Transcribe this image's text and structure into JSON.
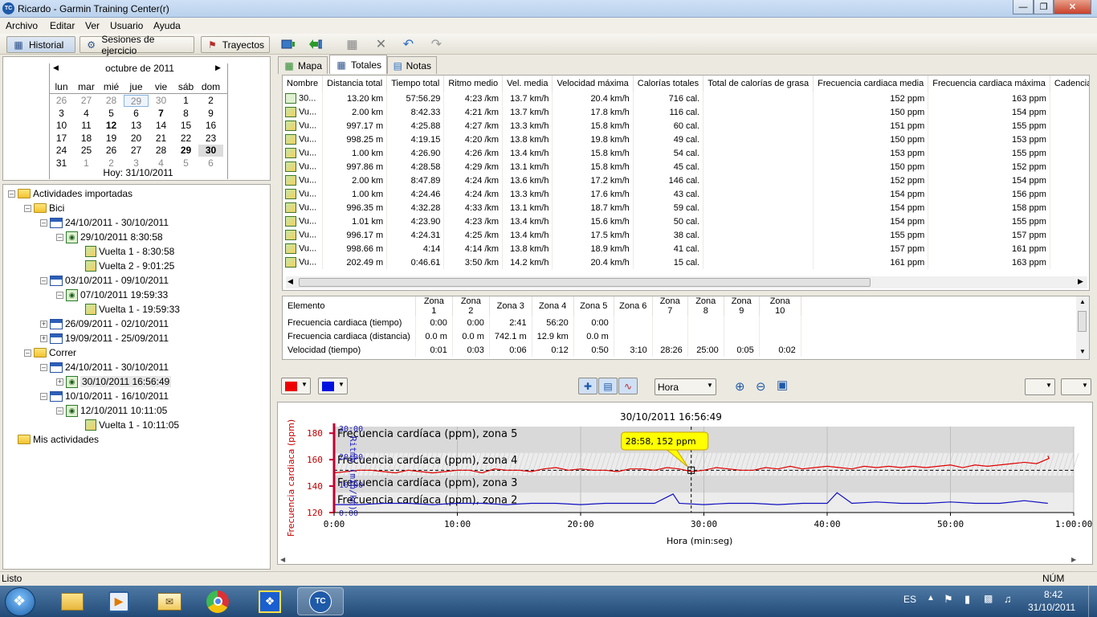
{
  "window": {
    "title": "Ricardo - Garmin Training Center(r)",
    "icon_text": "TC"
  },
  "menu": [
    "Archivo",
    "Editar",
    "Ver",
    "Usuario",
    "Ayuda"
  ],
  "toolbar": {
    "historial": "Historial",
    "sesiones": "Sesiones de ejercicio",
    "trayectos": "Trayectos"
  },
  "calendar": {
    "month": "octubre de 2011",
    "weekdays": [
      "lun",
      "mar",
      "mié",
      "jue",
      "vie",
      "sáb",
      "dom"
    ],
    "weeks": [
      [
        "26",
        "27",
        "28",
        "29",
        "30",
        "1",
        "2"
      ],
      [
        "3",
        "4",
        "5",
        "6",
        "7",
        "8",
        "9"
      ],
      [
        "10",
        "11",
        "12",
        "13",
        "14",
        "15",
        "16"
      ],
      [
        "17",
        "18",
        "19",
        "20",
        "21",
        "22",
        "23"
      ],
      [
        "24",
        "25",
        "26",
        "27",
        "28",
        "29",
        "30"
      ],
      [
        "31",
        "1",
        "2",
        "3",
        "4",
        "5",
        "6"
      ]
    ],
    "today": "Hoy: 31/10/2011"
  },
  "tree": {
    "root": "Actividades importadas",
    "bici": "Bici",
    "week1": "24/10/2011 - 30/10/2011",
    "act1": "29/10/2011 8:30:58",
    "lap1": "Vuelta 1 - 8:30:58",
    "lap2": "Vuelta 2 - 9:01:25",
    "week2": "03/10/2011 - 09/10/2011",
    "act2": "07/10/2011 19:59:33",
    "lap3": "Vuelta 1 - 19:59:33",
    "week3": "26/09/2011 - 02/10/2011",
    "week4": "19/09/2011 - 25/09/2011",
    "correr": "Correr",
    "week5": "24/10/2011 - 30/10/2011",
    "act3": "30/10/2011 16:56:49",
    "week6": "10/10/2011 - 16/10/2011",
    "act4": "12/10/2011 10:11:05",
    "lap4": "Vuelta 1 - 10:11:05",
    "mis": "Mis actividades"
  },
  "tabs": {
    "mapa": "Mapa",
    "totales": "Totales",
    "notas": "Notas"
  },
  "totals": {
    "columns": [
      "Nombre",
      "Distancia total",
      "Tiempo total",
      "Ritmo medio",
      "Vel. media",
      "Velocidad máxima",
      "Calorías totales",
      "Total de calorías de grasa",
      "Frecuencia cardiaca media",
      "Frecuencia cardiaca máxima",
      "Cadencia med"
    ],
    "rows": [
      [
        "30...",
        "13.20 km",
        "57:56.29",
        "4:23 /km",
        "13.7 km/h",
        "20.4 km/h",
        "716 cal.",
        "",
        "152 ppm",
        "163 ppm",
        ""
      ],
      [
        "Vu...",
        "2.00 km",
        "8:42.33",
        "4:21 /km",
        "13.7 km/h",
        "17.8 km/h",
        "116 cal.",
        "",
        "150 ppm",
        "154 ppm",
        ""
      ],
      [
        "Vu...",
        "997.17 m",
        "4:25.88",
        "4:27 /km",
        "13.3 km/h",
        "15.8 km/h",
        "60 cal.",
        "",
        "151 ppm",
        "155 ppm",
        ""
      ],
      [
        "Vu...",
        "998.25 m",
        "4:19.15",
        "4:20 /km",
        "13.8 km/h",
        "19.8 km/h",
        "49 cal.",
        "",
        "150 ppm",
        "153 ppm",
        ""
      ],
      [
        "Vu...",
        "1.00 km",
        "4:26.90",
        "4:26 /km",
        "13.4 km/h",
        "15.8 km/h",
        "54 cal.",
        "",
        "153 ppm",
        "155 ppm",
        ""
      ],
      [
        "Vu...",
        "997.86 m",
        "4:28.58",
        "4:29 /km",
        "13.1 km/h",
        "15.8 km/h",
        "45 cal.",
        "",
        "150 ppm",
        "152 ppm",
        ""
      ],
      [
        "Vu...",
        "2.00 km",
        "8:47.89",
        "4:24 /km",
        "13.6 km/h",
        "17.2 km/h",
        "146 cal.",
        "",
        "152 ppm",
        "154 ppm",
        ""
      ],
      [
        "Vu...",
        "1.00 km",
        "4:24.46",
        "4:24 /km",
        "13.3 km/h",
        "17.6 km/h",
        "43 cal.",
        "",
        "154 ppm",
        "156 ppm",
        ""
      ],
      [
        "Vu...",
        "996.35 m",
        "4:32.28",
        "4:33 /km",
        "13.1 km/h",
        "18.7 km/h",
        "59 cal.",
        "",
        "154 ppm",
        "158 ppm",
        ""
      ],
      [
        "Vu...",
        "1.01 km",
        "4:23.90",
        "4:23 /km",
        "13.4 km/h",
        "15.6 km/h",
        "50 cal.",
        "",
        "154 ppm",
        "155 ppm",
        ""
      ],
      [
        "Vu...",
        "996.17 m",
        "4:24.31",
        "4:25 /km",
        "13.4 km/h",
        "17.5 km/h",
        "38 cal.",
        "",
        "155 ppm",
        "157 ppm",
        ""
      ],
      [
        "Vu...",
        "998.66 m",
        "4:14",
        "4:14 /km",
        "13.8 km/h",
        "18.9 km/h",
        "41 cal.",
        "",
        "157 ppm",
        "161 ppm",
        ""
      ],
      [
        "Vu...",
        "202.49 m",
        "0:46.61",
        "3:50 /km",
        "14.2 km/h",
        "20.4 km/h",
        "15 cal.",
        "",
        "161 ppm",
        "163 ppm",
        ""
      ]
    ]
  },
  "zones": {
    "columns": [
      "Elemento",
      "Zona 1",
      "Zona 2",
      "Zona 3",
      "Zona 4",
      "Zona 5",
      "Zona 6",
      "Zona 7",
      "Zona 8",
      "Zona 9",
      "Zona 10"
    ],
    "rows": [
      [
        "Frecuencia cardiaca (tiempo)",
        "0:00",
        "0:00",
        "2:41",
        "56:20",
        "0:00",
        "",
        "",
        "",
        "",
        ""
      ],
      [
        "Frecuencia cardiaca (distancia)",
        "0.0 m",
        "0.0 m",
        "742.1 m",
        "12.9 km",
        "0.0 m",
        "",
        "",
        "",
        "",
        ""
      ],
      [
        "Velocidad (tiempo)",
        "0:01",
        "0:03",
        "0:06",
        "0:12",
        "0:50",
        "3:10",
        "28:26",
        "25:00",
        "0:05",
        "0:02"
      ]
    ]
  },
  "chart_controls": {
    "xaxis_select": "Hora"
  },
  "chart_data": {
    "type": "line",
    "title": "30/10/2011 16:56:49",
    "xlabel": "Hora (min:seg)",
    "ylabel": "Frecuencia cardiaca (ppm)",
    "y2label": "Ritmo (min/km)",
    "xticks": [
      "0:00",
      "10:00",
      "20:00",
      "30:00",
      "40:00",
      "50:00",
      "1:00:00"
    ],
    "xlim": [
      0,
      60
    ],
    "ylim": [
      120,
      185
    ],
    "yticks": [
      "120",
      "140",
      "160",
      "180"
    ],
    "y2ticks": [
      "0:00",
      "10:00",
      "20:00",
      "30:00"
    ],
    "zones": [
      "Frecuencia cardíaca (ppm), zona 5",
      "Frecuencia cardíaca (ppm), zona 4",
      "Frecuencia cardíaca (ppm), zona 3",
      "Frecuencia cardíaca (ppm), zona 2"
    ],
    "zone_bounds": [
      [
        165,
        185
      ],
      [
        148,
        165
      ],
      [
        135,
        148
      ],
      [
        120,
        135
      ]
    ],
    "tooltip": "28:58, 152 ppm",
    "cursor": {
      "x": 28.97,
      "y": 152
    },
    "series": [
      {
        "name": "Frecuencia cardiaca",
        "color": "#e00000",
        "x": [
          0,
          1,
          2,
          3,
          4,
          5,
          6,
          7,
          8,
          9,
          10,
          11,
          12,
          13,
          14,
          15,
          16,
          17,
          18,
          19,
          20,
          21,
          22,
          23,
          24,
          25,
          26,
          27,
          28,
          29,
          30,
          31,
          32,
          33,
          34,
          35,
          36,
          37,
          38,
          39,
          40,
          41,
          42,
          43,
          44,
          45,
          46,
          47,
          48,
          49,
          50,
          51,
          52,
          53,
          54,
          55,
          56,
          57,
          58,
          57.9
        ],
        "y": [
          150,
          151,
          152,
          152,
          151,
          150,
          152,
          151,
          150,
          151,
          152,
          152,
          150,
          153,
          152,
          152,
          151,
          153,
          154,
          152,
          153,
          152,
          152,
          151,
          153,
          153,
          152,
          154,
          153,
          151,
          152,
          154,
          153,
          152,
          152,
          154,
          153,
          155,
          153,
          154,
          155,
          154,
          153,
          155,
          154,
          155,
          154,
          155,
          154,
          155,
          156,
          154,
          156,
          155,
          156,
          157,
          158,
          157,
          161,
          163
        ]
      },
      {
        "name": "Ritmo",
        "color": "#1010c0",
        "x": [
          0,
          2,
          4,
          6,
          8,
          10,
          12,
          14,
          16,
          18,
          20,
          22,
          24,
          26,
          27.5,
          28,
          30,
          32,
          34,
          36,
          38,
          40,
          40.8,
          42,
          44,
          46,
          48,
          50,
          52,
          54,
          56,
          57.9
        ],
        "y": [
          126,
          126,
          127,
          127,
          126,
          127,
          127,
          126,
          127,
          127,
          126,
          127,
          127,
          127,
          134,
          127,
          126,
          127,
          127,
          126,
          127,
          127,
          135,
          127,
          128,
          127,
          127,
          128,
          127,
          127,
          129,
          127
        ]
      }
    ]
  },
  "status": {
    "left": "Listo",
    "right": "NÚM"
  },
  "taskbar": {
    "lang": "ES",
    "time": "8:42",
    "date": "31/10/2011"
  },
  "colors": {
    "hr_color_button": "#ee0000",
    "pace_color_button": "#0010e0",
    "accent": "#1e5aa8"
  }
}
